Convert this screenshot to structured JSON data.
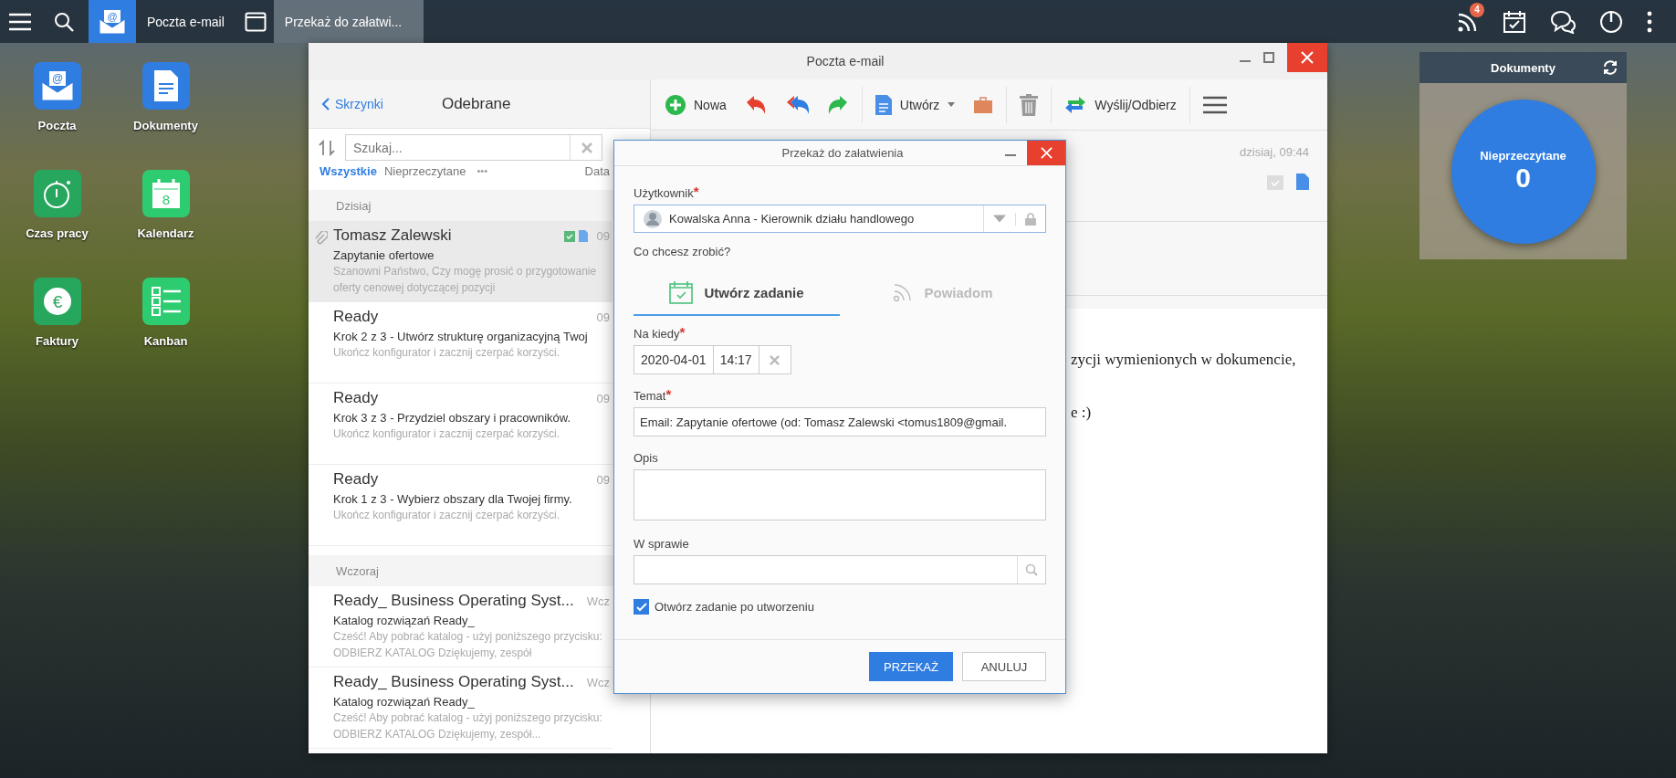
{
  "taskbar": {
    "tasks": [
      {
        "kind": "mail",
        "glyph": "@",
        "label": "Poczta e-mail",
        "selected": false
      },
      {
        "kind": "window",
        "label": "Przekaż do załatwi...",
        "selected": true
      }
    ],
    "notification_count": "4"
  },
  "desktop_icons": [
    {
      "kind": "mail",
      "glyph": "@",
      "label": "Poczta",
      "color": "#2f7de1"
    },
    {
      "kind": "document",
      "label": "Dokumenty",
      "color": "#2f7de1"
    },
    {
      "kind": "stopwatch",
      "label": "Czas pracy",
      "color": "#27a65e"
    },
    {
      "kind": "calendar",
      "glyph": "8",
      "label": "Kalendarz",
      "color": "#2ecc71"
    },
    {
      "kind": "invoice",
      "glyph": "€",
      "label": "Faktury",
      "color": "#27a65e"
    },
    {
      "kind": "kanban",
      "label": "Kanban",
      "color": "#2ecc71"
    }
  ],
  "mail_window": {
    "title": "Poczta e-mail",
    "back_link": "Skrzynki",
    "folder_title": "Odebrane",
    "search": {
      "placeholder": "Szukaj..."
    },
    "filters": [
      {
        "label": "Wszystkie",
        "selected": true
      },
      {
        "label": "Nieprzeczytane",
        "selected": false
      }
    ],
    "more": "•••",
    "sort_label": "Data",
    "groups": [
      {
        "label": "Dzisiaj",
        "messages": [
          {
            "sender": "Tomasz Zalewski",
            "time": "09",
            "subject": "Zapytanie ofertowe",
            "preview": "Szanowni Państwo, Czy mogę prosić o przygotowanie oferty cenowej dotyczącej pozycji",
            "selected": true,
            "attachment": true,
            "linked": true
          },
          {
            "sender": "Ready",
            "time": "09",
            "subject": "Krok 2 z 3 - Utwórz strukturę organizacyjną Twoj",
            "preview": "Ukończ konfigurator i zacznij czerpać korzyści.",
            "selected": false,
            "attachment": false,
            "linked": false
          },
          {
            "sender": "Ready",
            "time": "09",
            "subject": "Krok 3 z 3 - Przydziel obszary i pracowników.",
            "preview": "Ukończ konfigurator i zacznij czerpać korzyści.",
            "selected": false,
            "attachment": false,
            "linked": false
          },
          {
            "sender": "Ready",
            "time": "09",
            "subject": "Krok 1 z 3 - Wybierz obszary dla Twojej firmy.",
            "preview": "Ukończ konfigurator i zacznij czerpać korzyści.",
            "selected": false,
            "attachment": false,
            "linked": false
          }
        ]
      },
      {
        "label": "Wczoraj",
        "messages": [
          {
            "sender": "Ready_ Business Operating Syst...",
            "time": "Wcz",
            "subject": "Katalog rozwiązań Ready_",
            "preview": "Cześć! Aby pobrać katalog - użyj poniższego przycisku: ODBIERZ KATALOG Dziękujemy, zespół",
            "selected": false,
            "attachment": false,
            "linked": false
          },
          {
            "sender": "Ready_ Business Operating Syst...",
            "time": "Wcz",
            "subject": "Katalog rozwiązań Ready_",
            "preview": "Cześć! Aby pobrać katalog - użyj poniższego przycisku: ODBIERZ KATALOG Dziękujemy, zespół...",
            "selected": false,
            "attachment": false,
            "linked": false
          }
        ]
      }
    ],
    "toolbar": [
      {
        "kind": "new",
        "label": "Nowa"
      },
      {
        "kind": "reply"
      },
      {
        "kind": "reply-all"
      },
      {
        "kind": "forward"
      },
      {
        "kind": "divider"
      },
      {
        "kind": "create",
        "label": "Utwórz"
      },
      {
        "kind": "briefcase"
      },
      {
        "kind": "divider"
      },
      {
        "kind": "trash"
      },
      {
        "kind": "divider"
      },
      {
        "kind": "sync",
        "label": "Wyślij/Odbierz"
      },
      {
        "kind": "divider"
      },
      {
        "kind": "menu"
      }
    ],
    "preview": {
      "date": "dzisiaj, 09:44",
      "body_lines": [
        "zycji wymienionych w dokumencie,",
        "e :)"
      ]
    }
  },
  "documents_widget": {
    "title": "Dokumenty",
    "label": "Nieprzeczytane",
    "count": "0"
  },
  "dialog": {
    "title": "Przekaż do załatwienia",
    "user_label": "Użytkownik",
    "user_required": "*",
    "user_value": "Kowalska Anna - Kierownik działu handlowego",
    "action_label": "Co chcesz zrobić?",
    "actions": [
      {
        "kind": "task",
        "label": "Utwórz zadanie",
        "selected": true
      },
      {
        "kind": "notify",
        "label": "Powiadom",
        "selected": false
      }
    ],
    "due_label": "Na kiedy",
    "due_required": "*",
    "due_date": "2020-04-01",
    "due_time": "14:17",
    "subject_label": "Temat",
    "subject_required": "*",
    "subject_value": "Email: Zapytanie ofertowe (od: Tomasz Zalewski <tomus1809@gmail.",
    "description_label": "Opis",
    "case_label": "W sprawie",
    "open_after": {
      "label": "Otwórz zadanie po utworzeniu",
      "checked": true
    },
    "buttons": [
      {
        "kind": "primary",
        "label": "PRZEKAŻ"
      },
      {
        "kind": "secondary",
        "label": "ANULUJ"
      }
    ]
  }
}
